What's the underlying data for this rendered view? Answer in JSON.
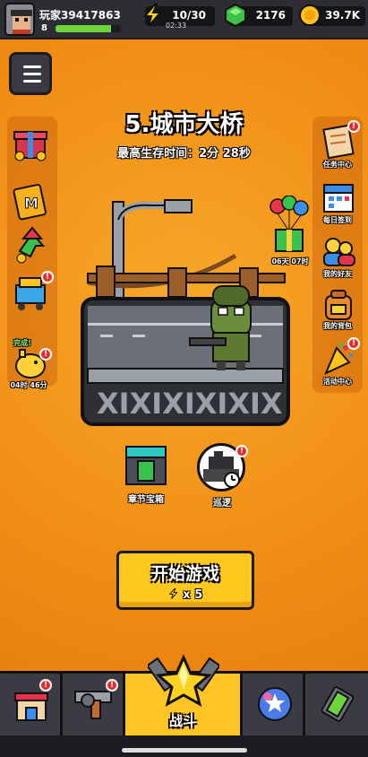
{
  "player": {
    "name": "玩家39417863",
    "level": "8",
    "xp_fraction": 0.85
  },
  "resources": {
    "energy": "10/30",
    "energy_timer": "02:33",
    "gems": "2176",
    "coins": "39.7K"
  },
  "stage": {
    "title": "5.城市大桥",
    "best_time": "最高生存时间：2分 28秒"
  },
  "left_side": {
    "limited_label": "完成!",
    "limited_timer": "04时 46分"
  },
  "right_side": {
    "gift_timer": "06天 07时",
    "items": [
      {
        "label": "任务中心",
        "icon": "task-scroll-icon"
      },
      {
        "label": "每日签到",
        "icon": "calendar-icon"
      },
      {
        "label": "我的好友",
        "icon": "friends-icon"
      },
      {
        "label": "我的背包",
        "icon": "backpack-icon"
      },
      {
        "label": "活动中心",
        "icon": "party-popper-icon"
      }
    ]
  },
  "actions": {
    "chapter_chest": "章节宝箱",
    "patrol": "巡逻",
    "start_game": "开始游戏",
    "start_cost": "x 5"
  },
  "nav": {
    "battle": "战斗"
  },
  "colors": {
    "background": "#ef8c14",
    "topbar": "#2d2d34",
    "start_button": "#ffc81f",
    "active_tab": "#ffc524",
    "badge": "#e82a2a"
  }
}
